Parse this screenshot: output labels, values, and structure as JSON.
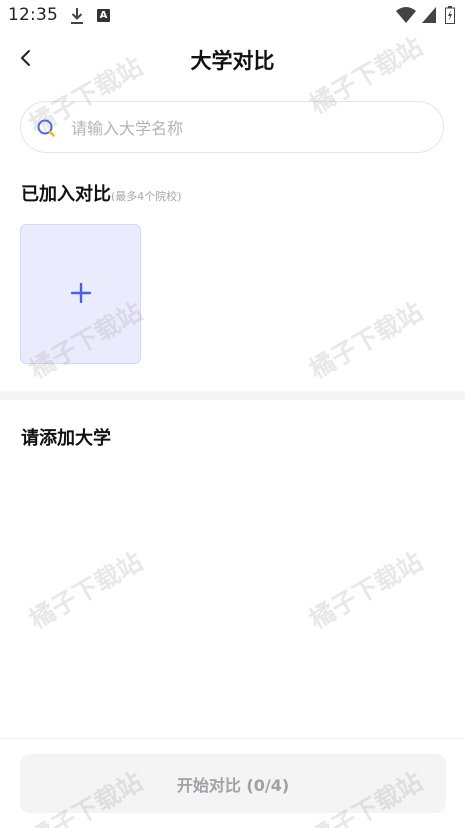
{
  "status_bar": {
    "time": "12:35",
    "notification_letter": "A"
  },
  "header": {
    "title": "大学对比"
  },
  "search": {
    "placeholder": "请输入大学名称"
  },
  "added": {
    "title": "已加入对比",
    "hint": "(最多4个院校)"
  },
  "suggest": {
    "title": "请添加大学"
  },
  "footer": {
    "start_label": "开始对比 (0/4)"
  },
  "watermark": {
    "text": "橘子下载站"
  },
  "colors": {
    "accent": "#4a5ee8",
    "card_bg": "#ebebfe",
    "search_icon_accent": "#f0b81f"
  }
}
